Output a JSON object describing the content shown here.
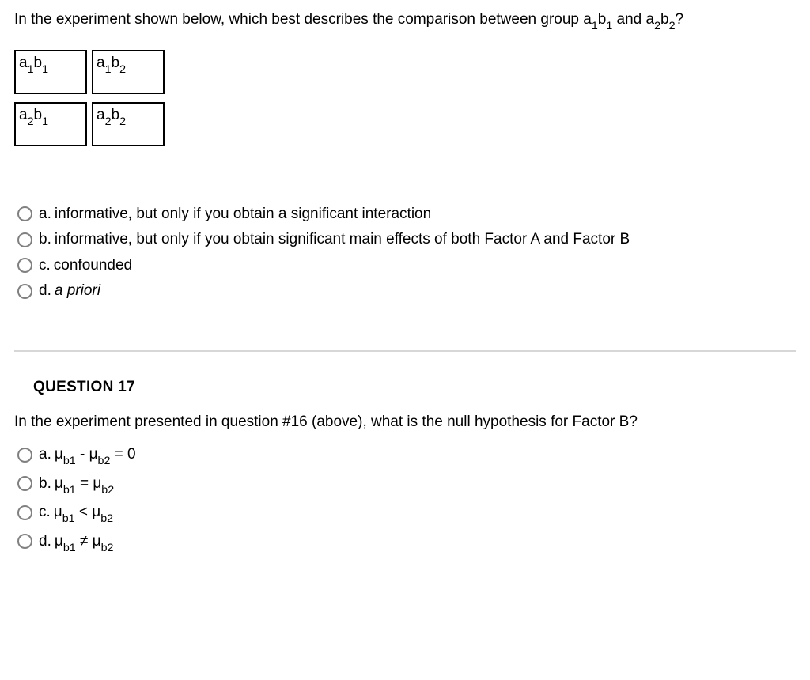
{
  "q16": {
    "prompt_pre": "In the experiment shown below, which best describes the comparison between group a",
    "prompt_mid": " and a",
    "prompt_post": "?",
    "cells": {
      "r1c1": {
        "a": "a",
        "ai": "1",
        "b": "b",
        "bi": "1"
      },
      "r1c2": {
        "a": "a",
        "ai": "1",
        "b": "b",
        "bi": "2"
      },
      "r2c1": {
        "a": "a",
        "ai": "2",
        "b": "b",
        "bi": "1"
      },
      "r2c2": {
        "a": "a",
        "ai": "2",
        "b": "b",
        "bi": "2"
      }
    },
    "options": [
      {
        "letter": "a.",
        "text": "informative, but only if you obtain a significant interaction"
      },
      {
        "letter": "b.",
        "text": "informative, but only if you obtain significant main effects of both Factor A and Factor B"
      },
      {
        "letter": "c.",
        "text": "confounded"
      },
      {
        "letter": "d.",
        "text": "a priori",
        "italic": true
      }
    ]
  },
  "q17": {
    "heading": "QUESTION 17",
    "prompt": "In the experiment presented in question #16 (above), what is the null hypothesis for Factor B?",
    "options": [
      {
        "letter": "a.",
        "lhs": "μ",
        "lhsi": "b1",
        "op": " - ",
        "rhs": "μ",
        "rhsi": "b2",
        "tail": " = 0"
      },
      {
        "letter": "b.",
        "lhs": "μ",
        "lhsi": "b1",
        "op": " = ",
        "rhs": "μ",
        "rhsi": "b2",
        "tail": ""
      },
      {
        "letter": "c.",
        "lhs": "μ",
        "lhsi": "b1",
        "op": " < ",
        "rhs": "μ",
        "rhsi": "b2",
        "tail": ""
      },
      {
        "letter": "d.",
        "lhs": "μ",
        "lhsi": "b1",
        "op": " ≠ ",
        "rhs": "μ",
        "rhsi": "b2",
        "tail": ""
      }
    ]
  }
}
